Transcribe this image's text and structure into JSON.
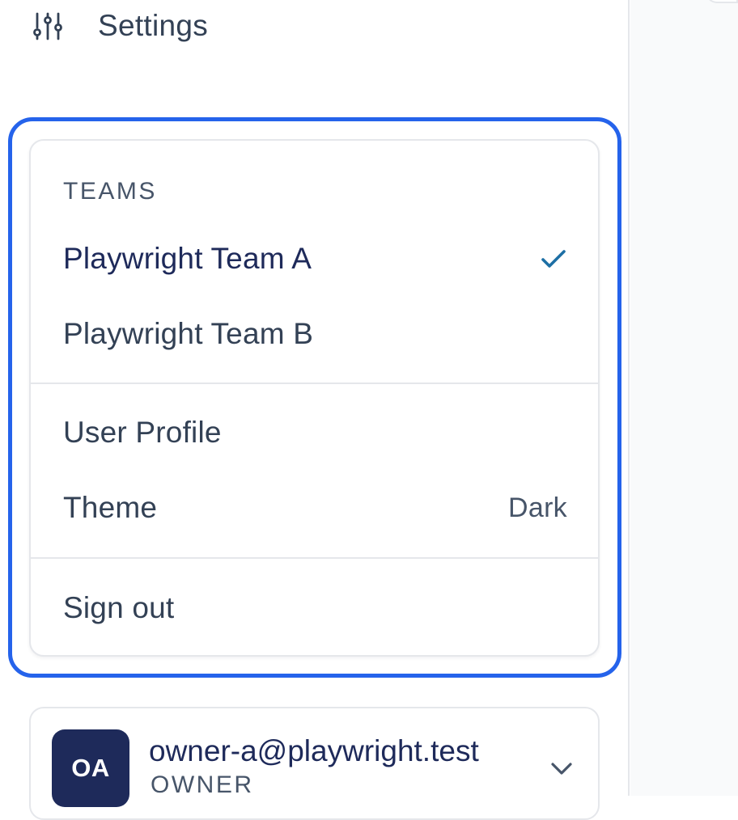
{
  "nav": {
    "settings_label": "Settings",
    "settings_icon": "sliders-icon"
  },
  "menu": {
    "teams_heading": "TEAMS",
    "teams": [
      {
        "label": "Playwright Team A",
        "selected": true
      },
      {
        "label": "Playwright Team B",
        "selected": false
      }
    ],
    "user_profile_label": "User Profile",
    "theme_label": "Theme",
    "theme_value": "Dark",
    "sign_out_label": "Sign out"
  },
  "user": {
    "initials": "OA",
    "email": "owner-a@playwright.test",
    "role": "OWNER"
  },
  "colors": {
    "accent": "#2563eb",
    "brand_navy": "#1e2a5a",
    "check": "#1d6fa5",
    "border": "#e5e7eb"
  },
  "icons": {
    "selected_team": "check-icon",
    "user_menu": "chevron-down-icon"
  }
}
